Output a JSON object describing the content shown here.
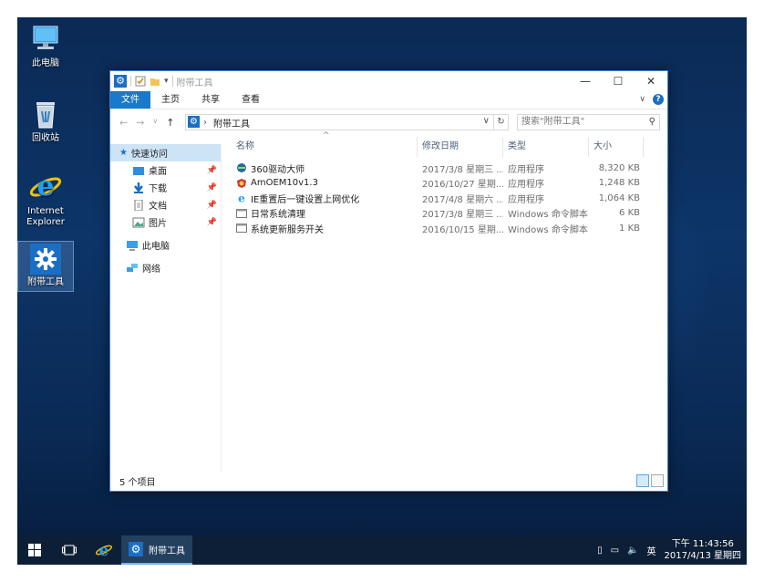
{
  "desktop": {
    "icons": [
      {
        "label": "此电脑",
        "icon": "computer-icon"
      },
      {
        "label": "回收站",
        "icon": "recycle-bin-icon"
      },
      {
        "label1": "Internet",
        "label2": "Explorer",
        "icon": "internet-explorer-icon"
      },
      {
        "label": "附带工具",
        "icon": "gear-icon"
      }
    ]
  },
  "window": {
    "title": "附带工具",
    "ribbon_tabs": [
      "文件",
      "主页",
      "共享",
      "查看"
    ],
    "address": {
      "crumb": "附带工具"
    },
    "search_placeholder": "搜索\"附带工具\"",
    "nav_pane": {
      "quick_access": "快速访问",
      "pinned": [
        "桌面",
        "下载",
        "文档",
        "图片"
      ],
      "this_pc": "此电脑",
      "network": "网络"
    },
    "columns": [
      "名称",
      "修改日期",
      "类型",
      "大小"
    ],
    "files": [
      {
        "name": "360驱动大师",
        "date": "2017/3/8 星期三 ...",
        "type": "应用程序",
        "size": "8,320 KB",
        "icon": "driver-app-icon"
      },
      {
        "name": "AmOEM10v1.3",
        "date": "2016/10/27 星期...",
        "type": "应用程序",
        "size": "1,248 KB",
        "icon": "oem-app-icon"
      },
      {
        "name": "IE重置后一键设置上网优化",
        "date": "2017/4/8 星期六 ...",
        "type": "应用程序",
        "size": "1,064 KB",
        "icon": "ie-app-icon"
      },
      {
        "name": "日常系统清理",
        "date": "2017/3/8 星期三 ...",
        "type": "Windows 命令脚本",
        "size": "6 KB",
        "icon": "script-icon"
      },
      {
        "name": "系统更新服务开关",
        "date": "2016/10/15 星期...",
        "type": "Windows 命令脚本",
        "size": "1 KB",
        "icon": "script-icon"
      }
    ],
    "status": "5 个项目"
  },
  "taskbar": {
    "app_label": "附带工具",
    "ime": "英",
    "time": "下午 11:43:56",
    "date": "2017/4/13 星期四"
  },
  "colors": {
    "accent": "#1979ca",
    "selection": "#cde4f7",
    "taskbar": "#0d1f36"
  }
}
